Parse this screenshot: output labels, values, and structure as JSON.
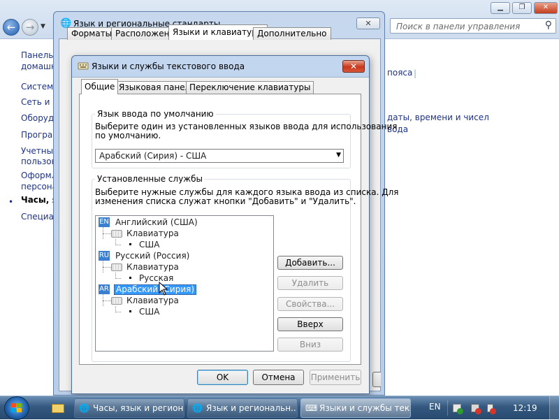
{
  "control_panel": {
    "search_placeholder": "Поиск в панели управления",
    "window_buttons": {
      "minimize": "▁",
      "maximize": "❐",
      "close": "✕"
    },
    "sidebar": [
      "Панель управления - домашняя страница",
      "Система и безопасность",
      "Сеть и Интернет",
      "Оборудование и звук",
      "Программы",
      "Учетные записи пользователей",
      "Оформление и персонализация",
      "Часы, язык и регион",
      "Специальные возможности"
    ],
    "sidebar_display": [
      "Панель у",
      "домашн",
      "Система",
      "Сеть и И",
      "Оборудо",
      "Програм",
      "Учетные",
      "пользов",
      "Оформл",
      "персона",
      "Часы, яз",
      "Специал"
    ],
    "bullet": "•",
    "links": [
      "пояса",
      "даты, времени и чисел",
      "вода"
    ],
    "link_sep": "|"
  },
  "regional_window": {
    "title": "Язык и региональные стандарты",
    "close_label": "✕",
    "tabs": [
      "Форматы",
      "Расположение",
      "Языки и клавиатуры",
      "Дополнительно"
    ]
  },
  "dialog": {
    "title": "Языки и службы текстового ввода",
    "close_label": "✕",
    "tabs": [
      "Общие",
      "Языковая панель",
      "Переключение клавиатуры"
    ],
    "default_input": {
      "group_title": "Язык ввода по умолчанию",
      "description_line1": "Выберите один из установленных языков ввода для использования",
      "description_line2": "по умолчанию.",
      "selected": "Арабский (Сирия) - США"
    },
    "installed": {
      "group_title": "Установленные службы",
      "description_line1": "Выберите нужные службы для каждого языка ввода из списка. Для",
      "description_line2": "изменения списка служат кнопки \"Добавить\" и \"Удалить\".",
      "keyboard_label": "Клавиатура",
      "languages": [
        {
          "code": "EN",
          "name": "Английский (США)",
          "layout": "США",
          "selected": false
        },
        {
          "code": "RU",
          "name": "Русский (Россия)",
          "layout": "Русская",
          "selected": false
        },
        {
          "code": "AR",
          "name": "Арабский (Сирия)",
          "layout": "США",
          "selected": true
        }
      ]
    },
    "side_buttons": {
      "add": "Добавить...",
      "remove": "Удалить",
      "properties": "Свойства...",
      "up": "Вверх",
      "down": "Вниз"
    },
    "footer_buttons": {
      "ok": "OK",
      "cancel": "Отмена",
      "apply": "Применить"
    }
  },
  "taskbar": {
    "items": [
      {
        "label": "Часы, язык и регион",
        "active": false
      },
      {
        "label": "Язык и региональн...",
        "active": false
      },
      {
        "label": "Языки и службы тек...",
        "active": true
      }
    ],
    "language": "EN",
    "clock": "12:19"
  }
}
